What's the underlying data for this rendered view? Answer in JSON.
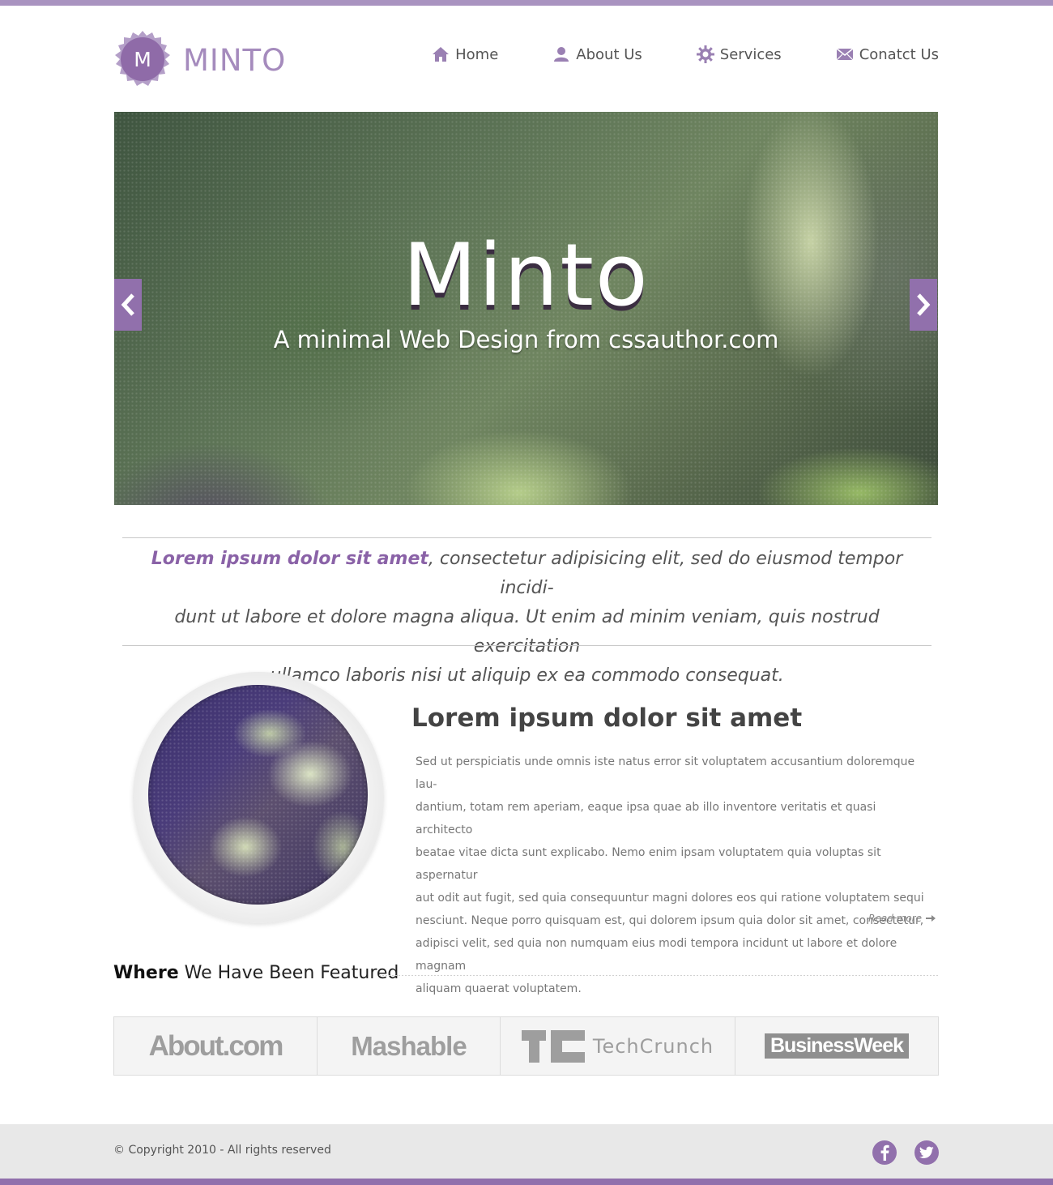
{
  "brand": {
    "initial": "M",
    "name": "MINTO",
    "accent": "#9170ac",
    "accent_light": "#a993c0"
  },
  "nav": {
    "items": [
      {
        "label": "Home",
        "icon": "home-icon"
      },
      {
        "label": "About Us",
        "icon": "user-icon"
      },
      {
        "label": "Services",
        "icon": "gear-icon"
      },
      {
        "label": "Conatct Us",
        "icon": "envelope-icon"
      }
    ]
  },
  "hero": {
    "title": "Minto",
    "subtitle": "A minimal Web Design  from cssauthor.com",
    "prev_icon": "chevron-left-icon",
    "next_icon": "chevron-right-icon"
  },
  "intro": {
    "highlight": "Lorem ipsum dolor sit amet",
    "line1_rest": ", consectetur adipisicing elit, sed do eiusmod tempor incidi-",
    "line2": "dunt ut labore et dolore magna aliqua. Ut enim ad minim veniam, quis nostrud exercitation",
    "line3": "ullamco laboris nisi ut aliquip ex ea commodo consequat."
  },
  "feature": {
    "title": "Lorem ipsum dolor sit amet",
    "lines": [
      "Sed ut perspiciatis unde omnis iste natus error sit voluptatem accusantium doloremque lau-",
      "dantium, totam rem aperiam, eaque ipsa quae ab illo inventore veritatis et quasi architecto",
      "beatae vitae dicta sunt explicabo. Nemo enim ipsam voluptatem quia voluptas sit aspernatur",
      "aut odit aut fugit, sed quia consequuntur magni dolores eos qui ratione voluptatem sequi",
      "nesciunt. Neque porro quisquam est, qui dolorem ipsum quia dolor sit amet, consectetur,",
      "adipisci velit, sed quia non numquam eius modi tempora incidunt ut labore et dolore magnam",
      "aliquam quaerat voluptatem."
    ],
    "read_more": "Read more"
  },
  "featured": {
    "heading_bold": "Where",
    "heading_rest": " We Have Been Featured",
    "logos": [
      "About.com",
      "Mashable",
      "TechCrunch",
      "BusinessWeek"
    ]
  },
  "footer": {
    "copyright": "© Copyright 2010 - All rights reserved",
    "social": [
      "facebook-icon",
      "twitter-icon"
    ]
  }
}
